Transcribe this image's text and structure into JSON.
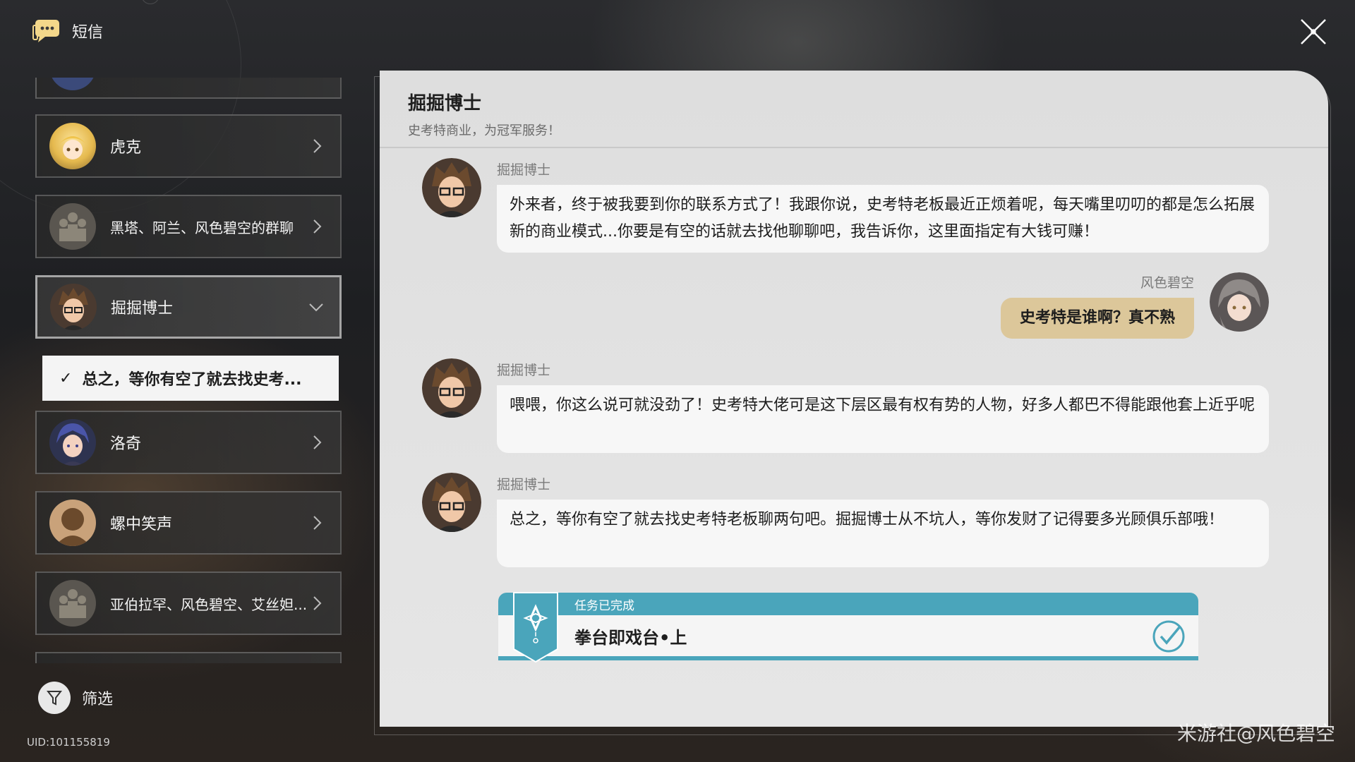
{
  "header": {
    "title": "短信",
    "icon": "message-icon"
  },
  "sidebar": {
    "contacts": [
      {
        "name": "",
        "avatar": "partial-avatar"
      },
      {
        "name": "虎克",
        "avatar": "blonde-girl-avatar"
      },
      {
        "name": "黑塔、阿兰、风色碧空的群聊",
        "avatar": "group-avatar"
      },
      {
        "name": "掘掘博士",
        "avatar": "glasses-man-avatar",
        "expanded": true
      },
      {
        "name": "洛奇",
        "avatar": "blue-hair-avatar"
      },
      {
        "name": "螺中笑声",
        "avatar": "silhouette-avatar"
      },
      {
        "name": "亚伯拉罕、风色碧空、艾丝妲...",
        "avatar": "group-avatar"
      }
    ],
    "sub_item": {
      "check": "✓",
      "label": "总之，等你有空了就去找史考..."
    },
    "filter_label": "筛选",
    "uid": "UID:101155819"
  },
  "chat": {
    "title": "掘掘博士",
    "subtitle": "史考特商业，为冠军服务！",
    "messages": [
      {
        "sender": "掘掘博士",
        "text": "外来者，终于被我要到你的联系方式了！我跟你说，史考特老板最近正烦着呢，每天嘴里叨叨的都是怎么拓展新的商业模式...你要是有空的话就去找他聊聊吧，我告诉你，这里面指定有大钱可赚！"
      },
      {
        "sender": "风色碧空",
        "text": "史考特是谁啊？真不熟"
      },
      {
        "sender": "掘掘博士",
        "text": "喂喂，你这么说可就没劲了！史考特大佬可是这下层区最有权有势的人物，好多人都巴不得能跟他套上近乎呢"
      },
      {
        "sender": "掘掘博士",
        "text": "总之，等你有空了就去找史考特老板聊两句吧。掘掘博士从不坑人，等你发财了记得要多光顾俱乐部哦！"
      }
    ],
    "task": {
      "status": "任务已完成",
      "name": "拳台即戏台•上"
    }
  },
  "watermark": "米游社@风色碧空",
  "colors": {
    "bubble_self": "#dcc79a",
    "task_accent": "#4aa5bb",
    "panel_bg": "#e2e2e2"
  }
}
